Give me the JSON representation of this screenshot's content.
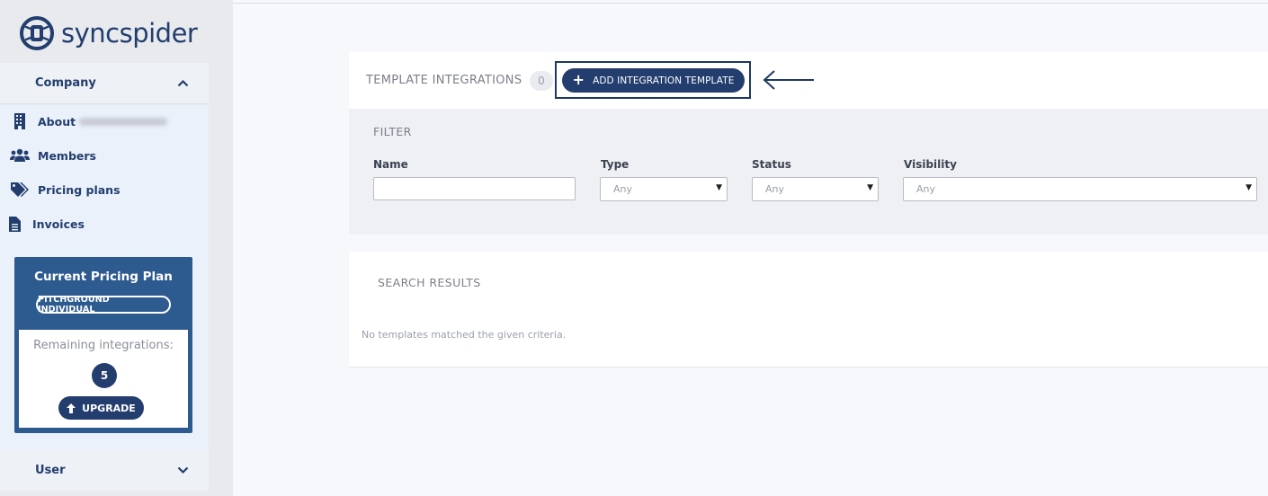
{
  "brand": {
    "name": "syncspider",
    "color": "#233e6e"
  },
  "sidebar": {
    "company_header": "Company",
    "menu": [
      {
        "label": "About",
        "icon": "building-icon"
      },
      {
        "label": "Members",
        "icon": "users-icon"
      },
      {
        "label": "Pricing plans",
        "icon": "tags-icon"
      },
      {
        "label": "Invoices",
        "icon": "document-icon"
      }
    ],
    "plan": {
      "title": "Current Pricing Plan",
      "name": "PITCHGROUND INDIVIDUAL",
      "remaining_label": "Remaining integrations:",
      "remaining_count": "5",
      "upgrade_label": "UPGRADE"
    },
    "user_header": "User"
  },
  "main": {
    "title": "TEMPLATE INTEGRATIONS",
    "count": "0",
    "add_button_label": "ADD INTEGRATION TEMPLATE",
    "filter": {
      "title": "FILTER",
      "name_label": "Name",
      "name_value": "",
      "type_label": "Type",
      "type_value": "Any",
      "status_label": "Status",
      "status_value": "Any",
      "visibility_label": "Visibility",
      "visibility_value": "Any"
    },
    "results": {
      "title": "SEARCH RESULTS",
      "empty_message": "No templates matched the given criteria."
    }
  },
  "colors": {
    "primary": "#233e6e",
    "plan_background": "#2d5a8f",
    "sidebar_background": "#e8eaee",
    "page_background": "#f7f8fb"
  }
}
